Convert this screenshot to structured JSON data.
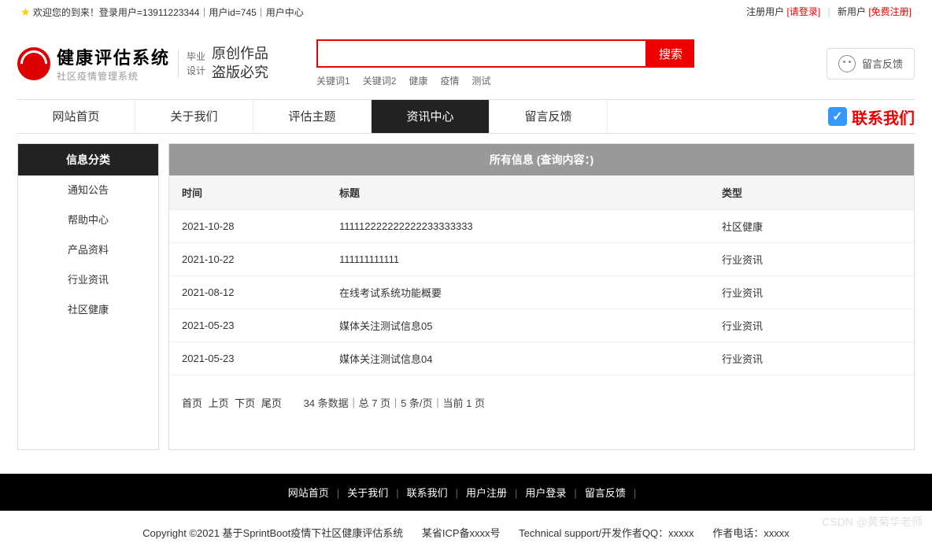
{
  "top": {
    "welcome": "欢迎您的到来！登录用户=13911223344｜用户id=745｜用户中心",
    "reg_user": "注册用户",
    "login_link": "[请登录]",
    "new_user": "新用户",
    "free_reg": "[免费注册]"
  },
  "logo": {
    "title": "健康评估系统",
    "sub": "社区疫情管理系统",
    "extra1": "毕业",
    "extra2": "设计",
    "script1": "原创作品",
    "script2": "盗版必究"
  },
  "search": {
    "button": "搜索",
    "keywords": [
      "关键词1",
      "关键词2",
      "健康",
      "疫情",
      "测试"
    ]
  },
  "feedback_btn": "留言反馈",
  "nav": {
    "items": [
      "网站首页",
      "关于我们",
      "评估主题",
      "资讯中心",
      "留言反馈"
    ],
    "active_index": 3,
    "contact": "联系我们"
  },
  "sidebar": {
    "header": "信息分类",
    "items": [
      "通知公告",
      "帮助中心",
      "产品资料",
      "行业资讯",
      "社区健康"
    ]
  },
  "main": {
    "header": "所有信息 (查询内容：)",
    "columns": [
      "时间",
      "标题",
      "类型"
    ],
    "rows": [
      {
        "time": "2021-10-28",
        "title": "111112222222222233333333",
        "type": "社区健康"
      },
      {
        "time": "2021-10-22",
        "title": "111111111111",
        "type": "行业资讯"
      },
      {
        "time": "2021-08-12",
        "title": "在线考试系统功能概要",
        "type": "行业资讯"
      },
      {
        "time": "2021-05-23",
        "title": "媒体关注测试信息05",
        "type": "行业资讯"
      },
      {
        "time": "2021-05-23",
        "title": "媒体关注测试信息04",
        "type": "行业资讯"
      }
    ],
    "pager_links": [
      "首页",
      "上页",
      "下页",
      "尾页"
    ],
    "pager_info": "34 条数据｜总 7 页｜5 条/页｜当前 1 页"
  },
  "footer": {
    "nav": [
      "网站首页",
      "关于我们",
      "联系我们",
      "用户注册",
      "用户登录",
      "留言反馈"
    ],
    "copy1": "Copyright ©2021 基于SprintBoot疫情下社区健康评估系统",
    "copy2": "某省ICP备xxxx号",
    "copy3": "Technical support/开发作者QQ：xxxxx",
    "copy4": "作者电话：xxxxx"
  },
  "watermark": "CSDN @黄菊华老师"
}
